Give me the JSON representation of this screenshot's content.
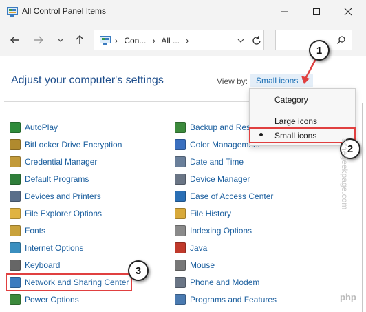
{
  "window": {
    "title": "All Control Panel Items"
  },
  "address": {
    "crumbs": [
      "Con...",
      "All ..."
    ]
  },
  "search": {
    "placeholder": ""
  },
  "header": {
    "heading": "Adjust your computer's settings",
    "view_by_label": "View by:",
    "view_by_value": "Small icons"
  },
  "menu": {
    "items": [
      "Category",
      "Large icons",
      "Small icons"
    ],
    "selected": "Small icons"
  },
  "items_left": [
    {
      "label": "AutoPlay",
      "icon": "autoplay-icon",
      "color": "#2e8b3a"
    },
    {
      "label": "BitLocker Drive Encryption",
      "icon": "bitlocker-icon",
      "color": "#b08a2e"
    },
    {
      "label": "Credential Manager",
      "icon": "credential-manager-icon",
      "color": "#c29a3a"
    },
    {
      "label": "Default Programs",
      "icon": "default-programs-icon",
      "color": "#2f7e3a"
    },
    {
      "label": "Devices and Printers",
      "icon": "devices-printers-icon",
      "color": "#5a6f8a"
    },
    {
      "label": "File Explorer Options",
      "icon": "folder-icon",
      "color": "#e0b341"
    },
    {
      "label": "Fonts",
      "icon": "fonts-icon",
      "color": "#c9a23c"
    },
    {
      "label": "Internet Options",
      "icon": "internet-options-icon",
      "color": "#3a8fbf"
    },
    {
      "label": "Keyboard",
      "icon": "keyboard-icon",
      "color": "#666666"
    },
    {
      "label": "Network and Sharing Center",
      "icon": "network-icon",
      "color": "#3a7bbf"
    },
    {
      "label": "Power Options",
      "icon": "power-options-icon",
      "color": "#3c8a3c"
    }
  ],
  "items_right": [
    {
      "label": "Backup and Rest",
      "icon": "backup-icon",
      "color": "#3c8a3c"
    },
    {
      "label": "Color Management",
      "icon": "color-management-icon",
      "color": "#3a6fbf"
    },
    {
      "label": "Date and Time",
      "icon": "date-time-icon",
      "color": "#6a7f9a"
    },
    {
      "label": "Device Manager",
      "icon": "device-manager-icon",
      "color": "#6a7585"
    },
    {
      "label": "Ease of Access Center",
      "icon": "ease-of-access-icon",
      "color": "#2a6fb5"
    },
    {
      "label": "File History",
      "icon": "file-history-icon",
      "color": "#d8a93a"
    },
    {
      "label": "Indexing Options",
      "icon": "indexing-icon",
      "color": "#8a8a8a"
    },
    {
      "label": "Java",
      "icon": "java-icon",
      "color": "#c0392b"
    },
    {
      "label": "Mouse",
      "icon": "mouse-icon",
      "color": "#777777"
    },
    {
      "label": "Phone and Modem",
      "icon": "phone-modem-icon",
      "color": "#6a7585"
    },
    {
      "label": "Programs and Features",
      "icon": "programs-features-icon",
      "color": "#4a7ab0"
    }
  ],
  "callouts": [
    "1",
    "2",
    "3"
  ],
  "watermark": "©thegeekpage.com",
  "watermark_logo": "php",
  "colors": {
    "accent": "#1a6fb5",
    "link": "#1a5e9e",
    "annotation": "#e04040"
  }
}
